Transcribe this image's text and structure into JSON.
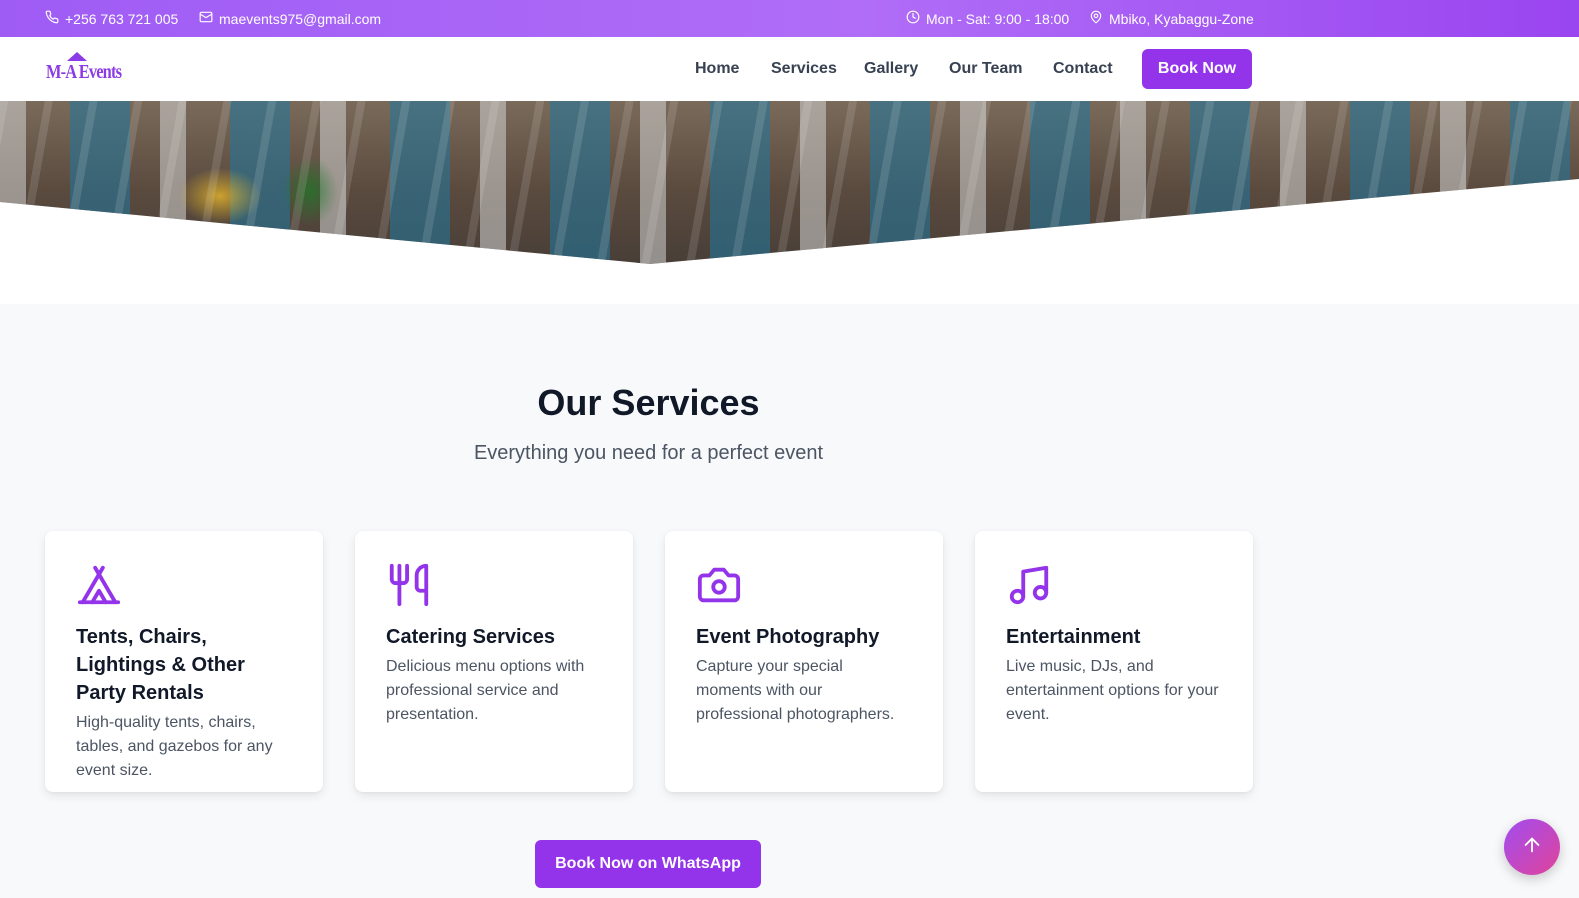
{
  "topbar": {
    "phone": "+256 763 721 005",
    "email": "maevents975@gmail.com",
    "hours": "Mon - Sat: 9:00 - 18:00",
    "location": "Mbiko, Kyabaggu-Zone",
    "icons": [
      "phone-icon",
      "mail-icon",
      "clock-icon",
      "map-pin-icon"
    ]
  },
  "nav": {
    "logo_text": "M-A Events",
    "links": [
      "Home",
      "Services",
      "Gallery",
      "Our Team",
      "Contact"
    ],
    "book_label": "Book Now"
  },
  "services": {
    "title": "Our Services",
    "subtitle": "Everything you need for a perfect event",
    "cards": [
      {
        "icon": "tent-icon",
        "title": "Tents, Chairs, Lightings & Other Party Rentals",
        "description": "High-quality tents, chairs, tables, and gazebos for any event size."
      },
      {
        "icon": "utensils-icon",
        "title": "Catering Services",
        "description": "Delicious menu options with professional service and presentation."
      },
      {
        "icon": "camera-icon",
        "title": "Event Photography",
        "description": "Capture your special moments with our professional photographers."
      },
      {
        "icon": "music-icon",
        "title": "Entertainment",
        "description": "Live music, DJs, and entertainment options for your event."
      }
    ],
    "whatsapp_label": "Book Now on WhatsApp"
  },
  "colors": {
    "accent": "#9333ea",
    "topbar_gradient_start": "#9f5cf5",
    "scroll_gradient_end": "#e0439a"
  }
}
